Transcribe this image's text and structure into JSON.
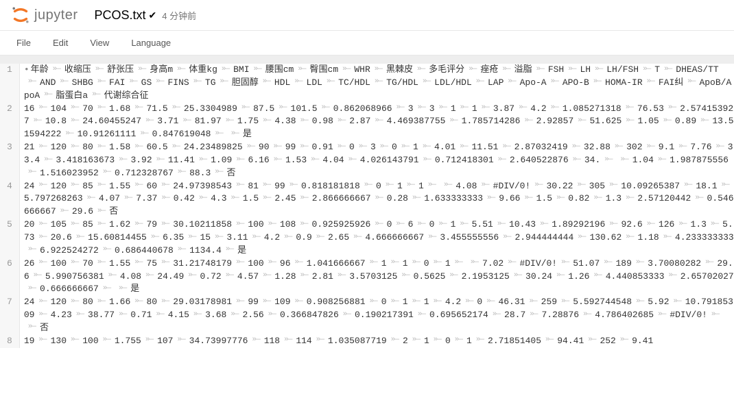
{
  "header": {
    "logo_text": "jupyter",
    "filename": "PCOS.txt",
    "timestamp": "4 分钟前"
  },
  "menubar": {
    "items": [
      "File",
      "Edit",
      "View",
      "Language"
    ]
  },
  "editor": {
    "lines": [
      {
        "num": "1",
        "first": true,
        "tokens": [
          "年龄",
          "收缩压",
          "舒张压",
          "身高m",
          "体重kg",
          "BMI",
          "腰围cm",
          "臀围cm",
          "WHR",
          "黑棘皮",
          "多毛评分",
          "痤疮",
          "溢脂",
          "FSH",
          "LH",
          "LH/FSH",
          "T",
          "DHEAS/TT",
          "AND",
          "SHBG",
          "FAI",
          "GS",
          "FINS",
          "TG",
          "胆固醇",
          "HDL",
          "LDL",
          "TC/HDL",
          "TG/HDL",
          "LDL/HDL",
          "LAP",
          "Apo-A",
          "APO-B",
          "HOMA-IR",
          "FAI纠",
          "ApoB/ApoA",
          "脂蛋白a",
          "代谢综合征"
        ]
      },
      {
        "num": "2",
        "tokens": [
          "16",
          "104",
          "70",
          "1.68",
          "71.5",
          "25.3304989",
          "87.5",
          "101.5",
          "0.862068966",
          "3",
          "3",
          "1",
          "1",
          "3.87",
          "4.2",
          "1.085271318",
          "76.53",
          "2.574153927",
          "10.8",
          "24.60455247",
          "3.71",
          "81.97",
          "1.75",
          "4.38",
          "0.98",
          "2.87",
          "4.469387755",
          "1.785714286",
          "2.92857",
          "51.625",
          "1.05",
          "0.89",
          "13.51594222",
          "10.91261111",
          "0.847619048",
          "",
          "是"
        ]
      },
      {
        "num": "3",
        "tokens": [
          "21",
          "120",
          "80",
          "1.58",
          "60.5",
          "24.23489825",
          "90",
          "99",
          "0.91",
          "0",
          "3",
          "0",
          "1",
          "4.01",
          "11.51",
          "2.87032419",
          "32.88",
          "302",
          "9.1",
          "7.76",
          "33.4",
          "3.418163673",
          "3.92",
          "11.41",
          "1.09",
          "6.16",
          "1.53",
          "4.04",
          "4.026143791",
          "0.712418301",
          "2.640522876",
          "34.",
          "",
          "1.04",
          "1.987875556",
          "1.516023952",
          "0.712328767",
          "88.3",
          "否"
        ]
      },
      {
        "num": "4",
        "tokens": [
          "24",
          "120",
          "85",
          "1.55",
          "60",
          "24.97398543",
          "81",
          "99",
          "0.818181818",
          "0",
          "1",
          "1",
          "",
          "4.08",
          "#DIV/0!",
          "30.22",
          "305",
          "10.09265387",
          "18.1",
          "5.797268263",
          "4.07",
          "7.37",
          "0.42",
          "4.3",
          "1.5",
          "2.45",
          "2.866666667",
          "0.28",
          "1.633333333",
          "9.66",
          "1.5",
          "0.82",
          "1.3",
          "2.57120442",
          "0.546666667",
          "29.6",
          "否"
        ]
      },
      {
        "num": "5",
        "tokens": [
          "20",
          "105",
          "85",
          "1.62",
          "79",
          "30.10211858",
          "100",
          "108",
          "0.925925926",
          "0",
          "6",
          "0",
          "1",
          "5.51",
          "10.43",
          "1.89292196",
          "92.6",
          "126",
          "1.3",
          "5.73",
          "20.6",
          "15.60814455",
          "6.35",
          "15",
          "3.11",
          "4.2",
          "0.9",
          "2.65",
          "4.666666667",
          "3.455555556",
          "2.944444444",
          "130.62",
          "1.18",
          "4.233333333",
          "6.922524272",
          "0.686440678",
          "1134.4",
          "是"
        ]
      },
      {
        "num": "6",
        "tokens": [
          "26",
          "100",
          "70",
          "1.55",
          "75",
          "31.21748179",
          "100",
          "96",
          "1.041666667",
          "1",
          "1",
          "0",
          "1",
          "",
          "7.02",
          "#DIV/0!",
          "51.07",
          "189",
          "3.70080282",
          "29.6",
          "5.990756381",
          "4.08",
          "24.49",
          "0.72",
          "4.57",
          "1.28",
          "2.81",
          "3.5703125",
          "0.5625",
          "2.1953125",
          "30.24",
          "1.26",
          "4.440853333",
          "2.65702027",
          "0.666666667",
          "",
          "是"
        ]
      },
      {
        "num": "7",
        "tokens": [
          "24",
          "120",
          "80",
          "1.66",
          "80",
          "29.03178981",
          "99",
          "109",
          "0.908256881",
          "0",
          "1",
          "1",
          "4.2",
          "0",
          "46.31",
          "259",
          "5.592744548",
          "5.92",
          "10.79185309",
          "4.23",
          "38.77",
          "0.71",
          "4.15",
          "3.68",
          "2.56",
          "0.366847826",
          "0.190217391",
          "0.695652174",
          "28.7",
          "7.28876",
          "4.786402685",
          "#DIV/0!",
          "",
          "否"
        ]
      },
      {
        "num": "8",
        "tokens": [
          "19",
          "130",
          "100",
          "1.755",
          "107",
          "34.73997776",
          "118",
          "114",
          "1.035087719",
          "2",
          "1",
          "0",
          "1",
          "2.71851405",
          "94.41",
          "252",
          "9.41"
        ]
      }
    ]
  }
}
